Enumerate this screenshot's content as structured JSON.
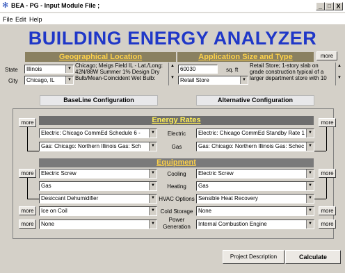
{
  "window": {
    "title": "BEA - PG - Input Module File ;",
    "min_label": "_",
    "max_label": "□",
    "close_label": "X"
  },
  "menu": [
    "File",
    "Edit",
    "Help"
  ],
  "app_title": "BUILDING ENERGY ANALYZER",
  "geo": {
    "header": "Geographical Location",
    "state_label": "State",
    "state_value": "Illinois",
    "city_label": "City",
    "city_value": "Chicago, IL",
    "description_lines": [
      "Chicago; Meigs Field IL - Lat./Long:",
      "42N/88W  Summer 1% Design Dry",
      "Bulb/Mean-Coincident Wet Bulb:"
    ]
  },
  "app_size": {
    "header": "Application Size and Type",
    "more_label": "more",
    "size_value": "60030",
    "size_unit": "sq. ft",
    "type_value": "Retail Store",
    "description_lines": [
      "Retail Store; 1-story slab on",
      "grade construction typical of a",
      "larger department store with 10"
    ]
  },
  "config": {
    "baseline": "BaseLine Configuration",
    "alternative": "Alternative Configuration"
  },
  "energy_rates": {
    "header": "Energy Rates",
    "rows": [
      {
        "label": "Electric",
        "baseline": "Electric: Chicago CommEd Schedule 6 -",
        "alternative": "Electric: Chicago CommEd Standby Rate 1"
      },
      {
        "label": "Gas",
        "baseline": "Gas: Chicago: Northern Illinois Gas: Sch",
        "alternative": "Gas: Chicago: Northern Illinois Gas: Schec"
      }
    ],
    "more_label": "more"
  },
  "equipment": {
    "header": "Equipment",
    "rows": [
      {
        "label": "Cooling",
        "baseline": "Electric Screw",
        "alternative": "Electric Screw"
      },
      {
        "label": "Heating",
        "baseline": "Gas",
        "alternative": "Gas"
      },
      {
        "label": "HVAC Options",
        "baseline": "Desiccant Dehumidifier",
        "alternative": "Sensible Heat Recovery"
      },
      {
        "label": "Cold Storage",
        "baseline": "Ice on Coil",
        "alternative": "None"
      },
      {
        "label": "Power Generation",
        "label_lines": [
          "Power",
          "Generation"
        ],
        "baseline": "None",
        "alternative": "Internal Combustion Engine"
      }
    ],
    "more_label": "more"
  },
  "footer": {
    "project_description": "Project Description",
    "calculate": "Calculate"
  },
  "colors": {
    "title": "#1f37c8",
    "header_text": "#ffd24a"
  }
}
